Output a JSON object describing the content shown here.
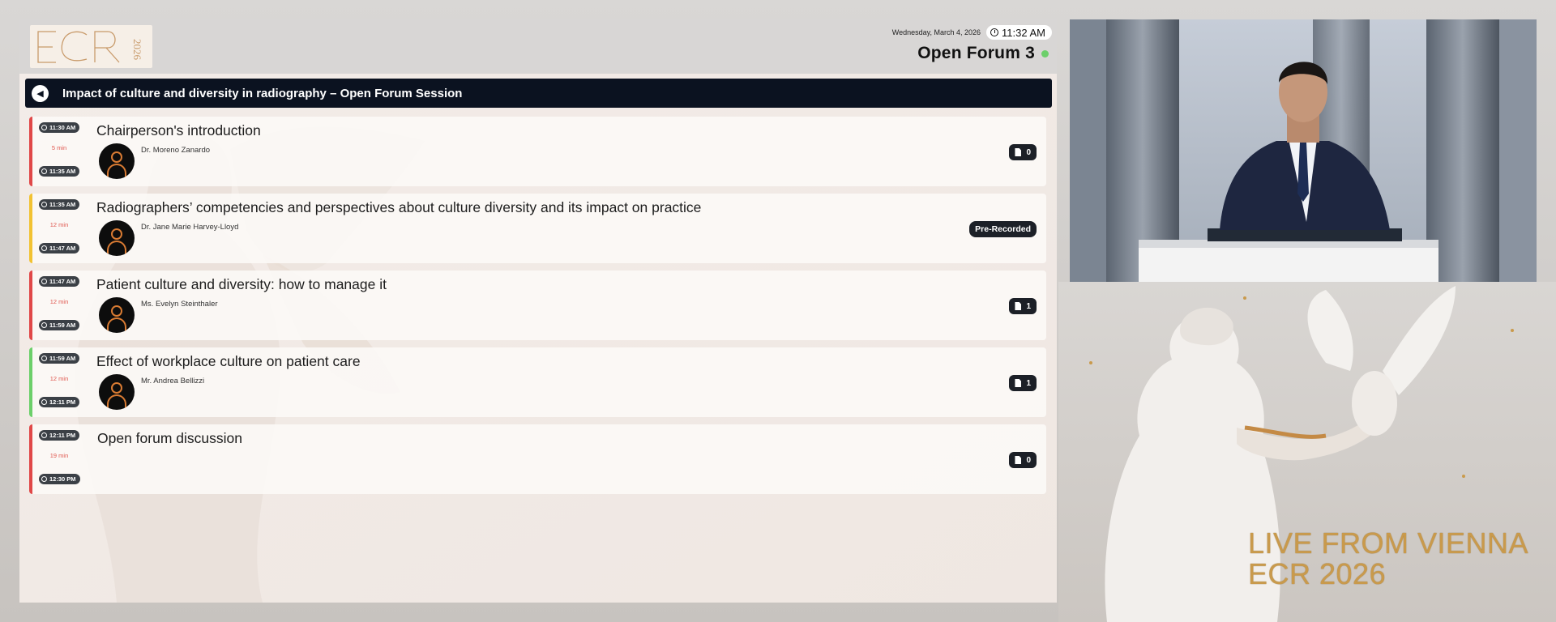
{
  "header": {
    "logo_alt": "ECR 2026",
    "date": "Wednesday, March 4, 2026",
    "time": "11:32 AM",
    "room": "Open Forum 3"
  },
  "session": {
    "title": "Impact of culture and diversity in radiography – Open Forum Session"
  },
  "talks": [
    {
      "start": "11:30 AM",
      "end": "11:35 AM",
      "duration": "5 min",
      "title": "Chairperson's introduction",
      "speaker": "Dr. Moreno Zanardo",
      "badge": "0",
      "stripe_color": "#e04848"
    },
    {
      "start": "11:35 AM",
      "end": "11:47 AM",
      "duration": "12 min",
      "title": "Radiographers’ competencies and perspectives about culture diversity and its impact on practice",
      "speaker": "Dr. Jane Marie Harvey-Lloyd",
      "badge": "Pre-Recorded",
      "stripe_color": "#f2c232"
    },
    {
      "start": "11:47 AM",
      "end": "11:59 AM",
      "duration": "12 min",
      "title": "Patient culture and diversity: how to manage it",
      "speaker": "Ms. Evelyn Steinthaler",
      "badge": "1",
      "stripe_color": "#e04848"
    },
    {
      "start": "11:59 AM",
      "end": "12:11 PM",
      "duration": "12 min",
      "title": "Effect of workplace culture on patient care",
      "speaker": "Mr. Andrea Bellizzi",
      "badge": "1",
      "stripe_color": "#6ccf6a"
    },
    {
      "start": "12:11 PM",
      "end": "12:30 PM",
      "duration": "19 min",
      "title": "Open forum discussion",
      "speaker": "",
      "badge": "0",
      "stripe_color": "#e04848"
    }
  ],
  "overlay": {
    "line1": "LIVE FROM VIENNA",
    "line2": "ECR 2026"
  },
  "colors": {
    "session_bar": "#0b1220",
    "accent_gold": "#c99a4c",
    "live_indicator": "#6ccf6a"
  }
}
